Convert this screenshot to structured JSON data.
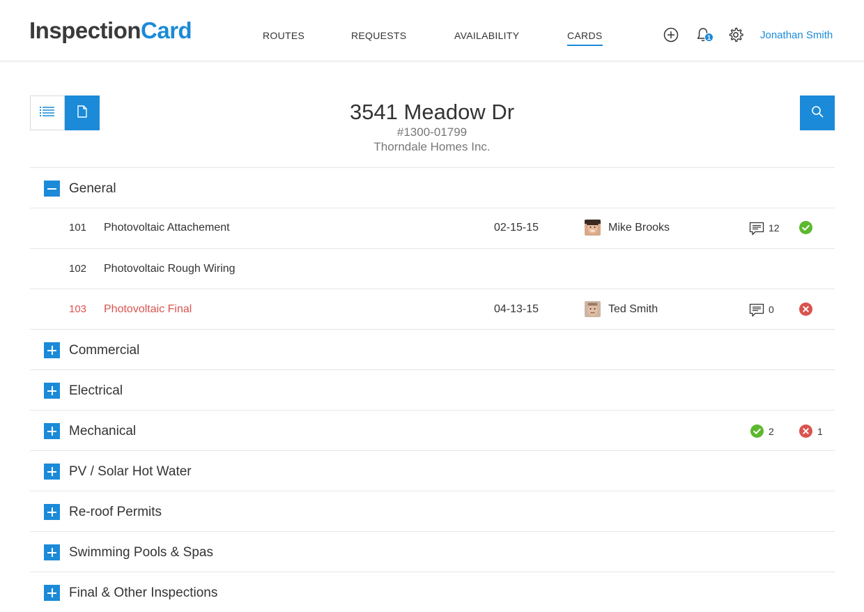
{
  "brand": {
    "part1": "Inspection",
    "part2": "Card"
  },
  "nav": [
    {
      "label": "ROUTES"
    },
    {
      "label": "REQUESTS"
    },
    {
      "label": "AVAILABILITY"
    },
    {
      "label": "CARDS",
      "active": true
    }
  ],
  "header_icons": {
    "add": "plus-circle-icon",
    "notifications": "bell-icon",
    "settings": "gear-icon"
  },
  "notification_count": "1",
  "user": {
    "name": "Jonathan Smith"
  },
  "toolbar": {
    "list_view": "list-icon",
    "card_view": "document-icon",
    "search": "search-icon"
  },
  "property": {
    "address": "3541 Meadow Dr",
    "permit": "#1300-01799",
    "builder": "Thorndale Homes Inc."
  },
  "sections": [
    {
      "label": "General",
      "expanded": true,
      "items": [
        {
          "num": "101",
          "name": "Photovoltaic Attachement",
          "date": "02-15-15",
          "inspector": "Mike Brooks",
          "comments": "12",
          "status": "pass"
        },
        {
          "num": "102",
          "name": "Photovoltaic Rough Wiring"
        },
        {
          "num": "103",
          "name": "Photovoltaic Final",
          "date": "04-13-15",
          "inspector": "Ted Smith",
          "comments": "0",
          "status": "fail"
        }
      ]
    },
    {
      "label": "Commercial",
      "expanded": false
    },
    {
      "label": "Electrical",
      "expanded": false
    },
    {
      "label": "Mechanical",
      "expanded": false,
      "passed": "2",
      "failed": "1"
    },
    {
      "label": "PV / Solar Hot Water",
      "expanded": false
    },
    {
      "label": "Re-roof Permits",
      "expanded": false
    },
    {
      "label": "Swimming Pools & Spas",
      "expanded": false
    },
    {
      "label": "Final & Other Inspections",
      "expanded": false
    }
  ],
  "colors": {
    "accent": "#1b8ad8",
    "pass": "#5cb82e",
    "fail": "#d9534f",
    "text": "#333333"
  }
}
